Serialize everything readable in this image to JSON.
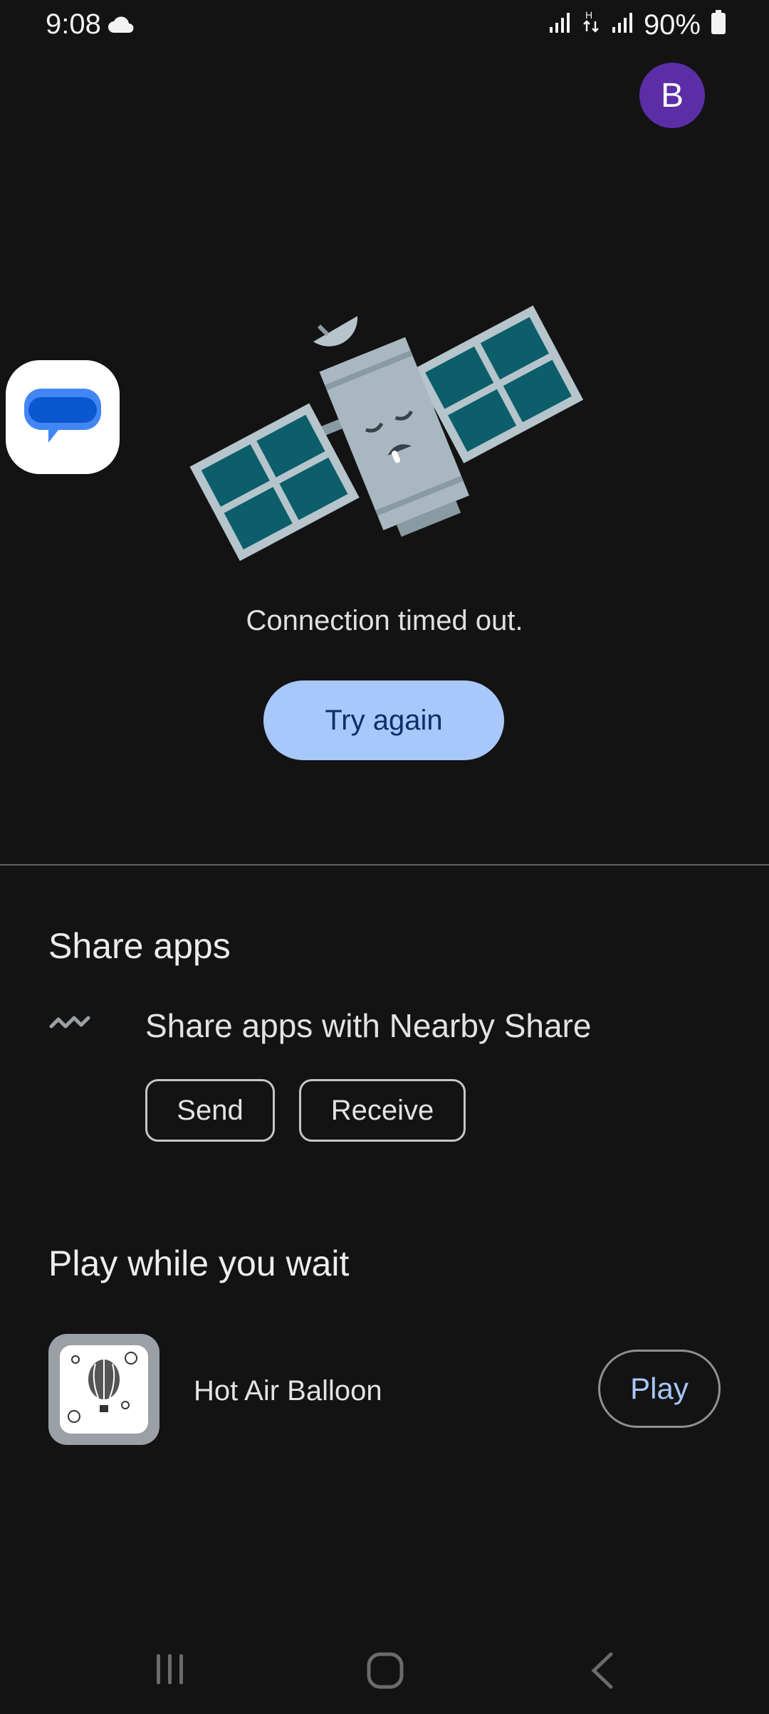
{
  "status_bar": {
    "time": "9:08",
    "battery": "90%",
    "icons": [
      "cloud-icon",
      "signal-icon",
      "data-icon",
      "signal-icon",
      "battery-icon"
    ]
  },
  "account": {
    "initial": "B"
  },
  "error": {
    "message": "Connection timed out.",
    "retry_label": "Try again"
  },
  "share": {
    "title": "Share apps",
    "description": "Share apps with Nearby Share",
    "send_label": "Send",
    "receive_label": "Receive"
  },
  "play": {
    "title": "Play while you wait",
    "game_name": "Hot Air Balloon",
    "play_label": "Play"
  },
  "colors": {
    "background": "#131314",
    "accent": "#a8c7fa",
    "avatar": "#5b2ea6"
  },
  "nav_bar": [
    "recents-icon",
    "home-icon",
    "back-icon"
  ]
}
